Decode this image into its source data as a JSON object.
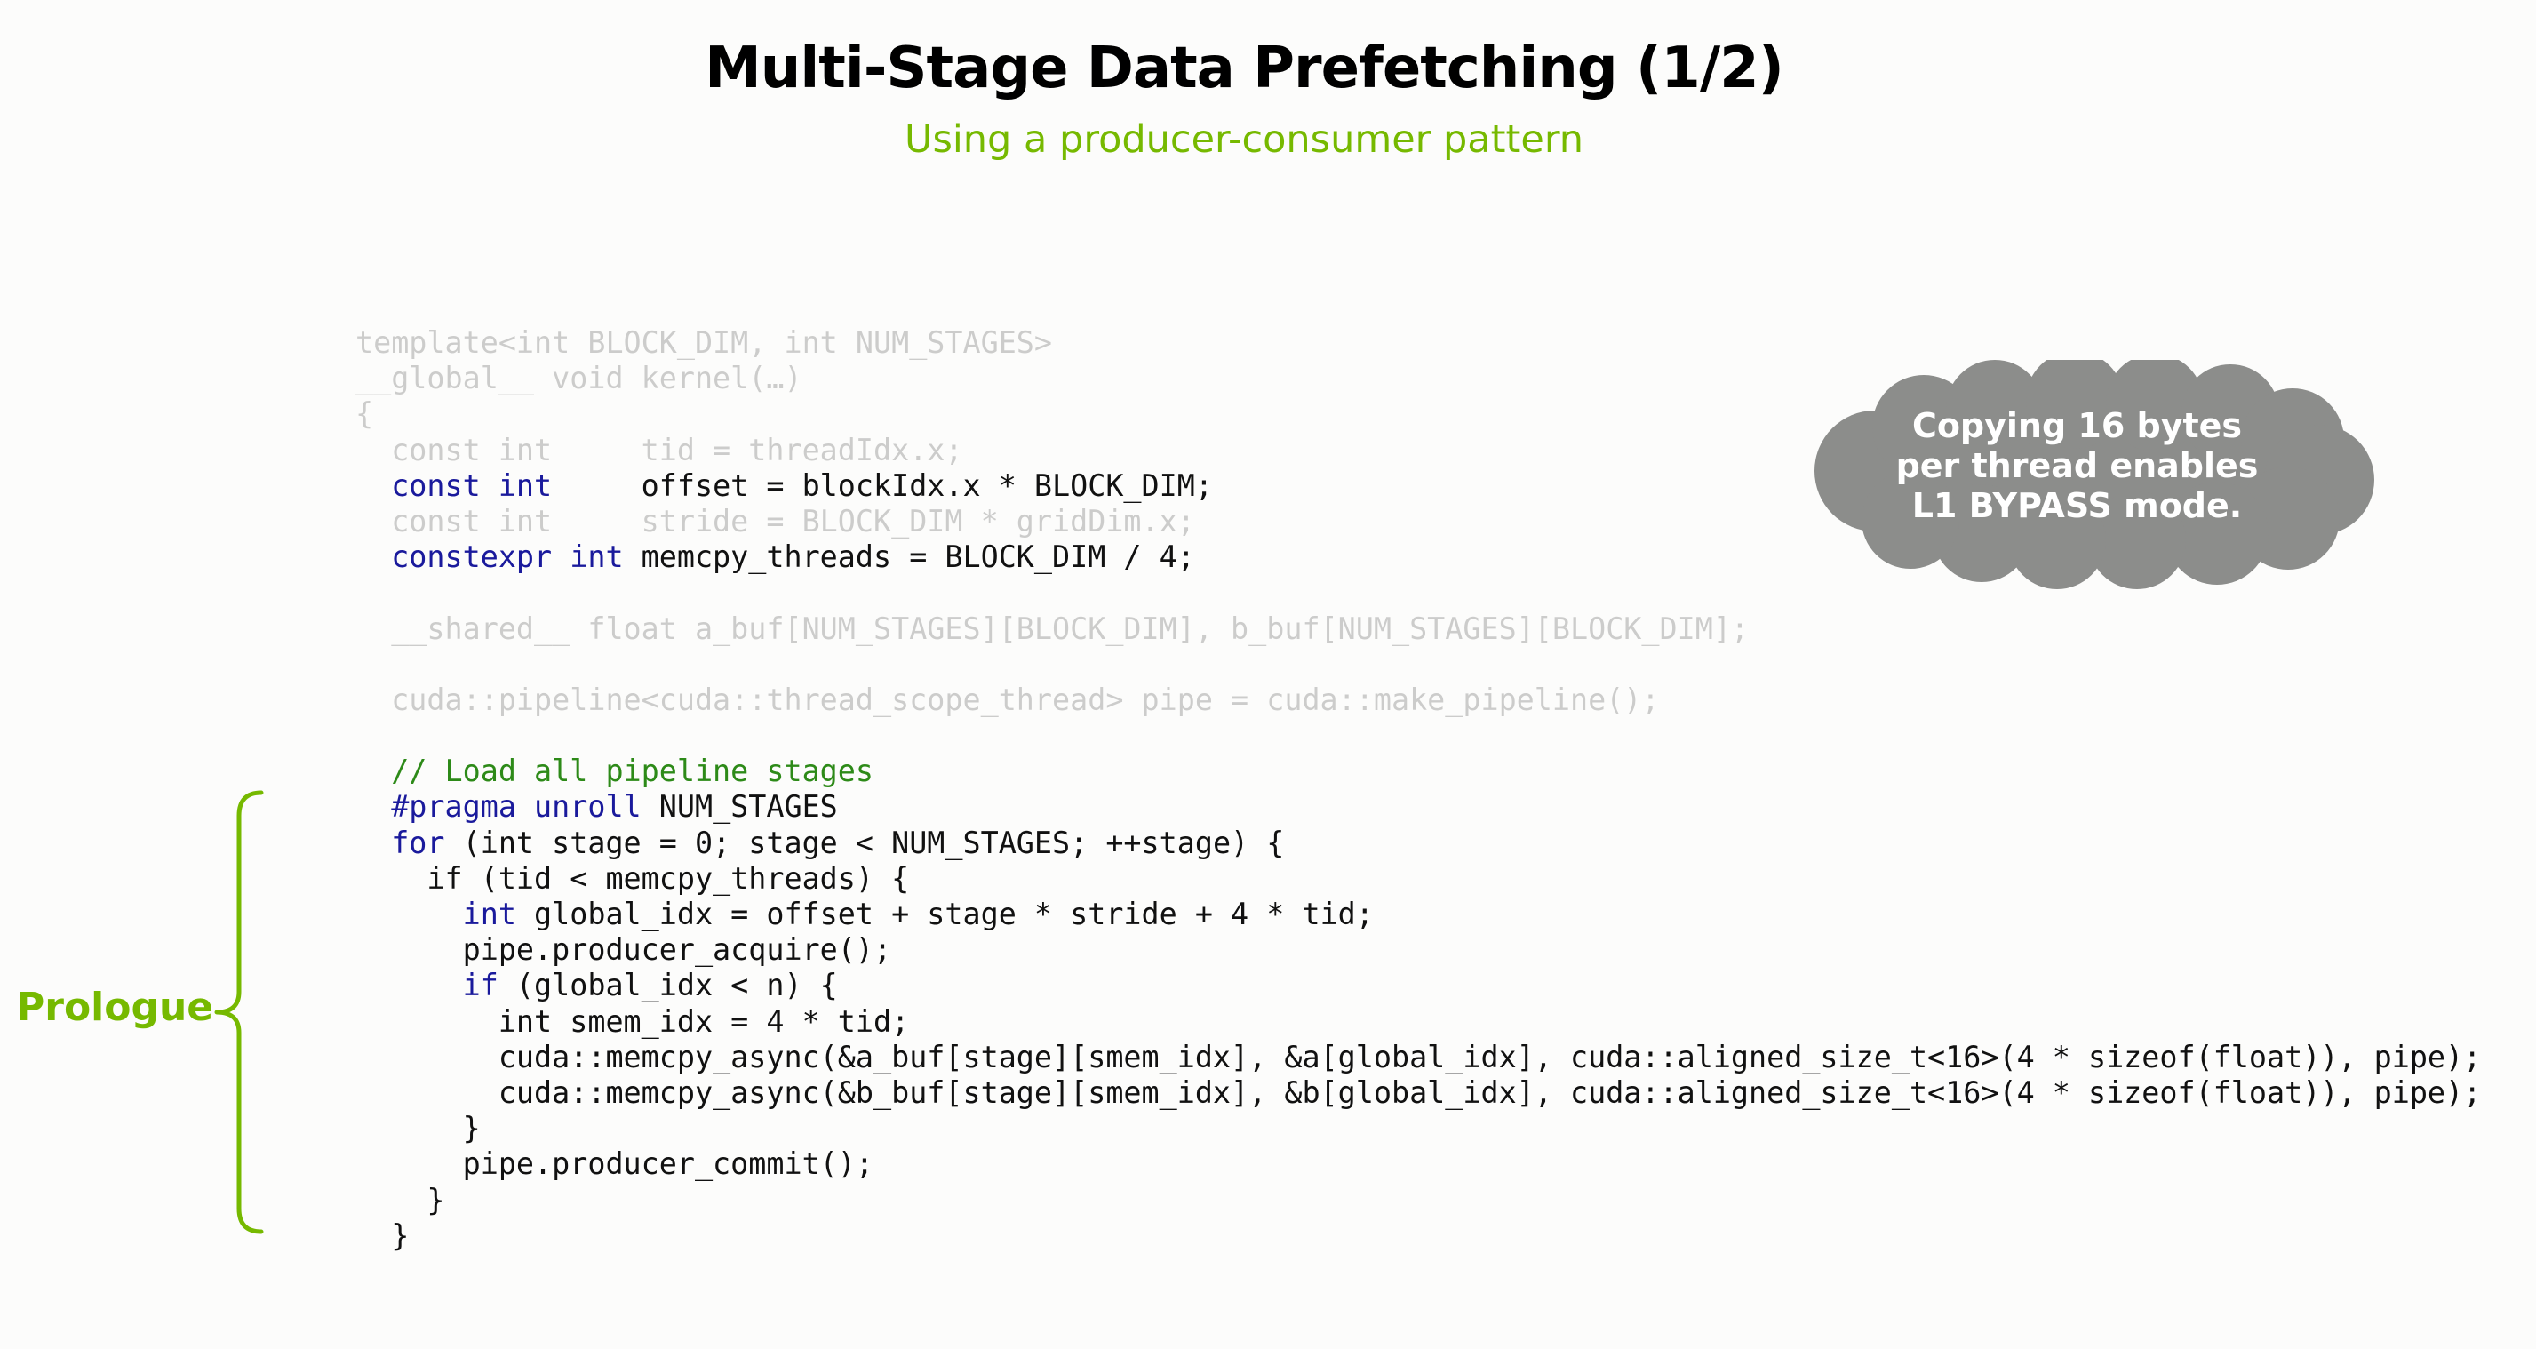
{
  "slide": {
    "title": "Multi-Stage Data Prefetching (1/2)",
    "subtitle": "Using a producer-consumer pattern"
  },
  "callout": {
    "line1": "Copying 16 bytes",
    "line2": "per thread enables",
    "line3": "L1 BYPASS mode."
  },
  "annotation": {
    "label": "Prologue"
  },
  "colors": {
    "accent_green": "#76b900",
    "keyword_blue": "#1a1a9c",
    "comment_green": "#2d8a18",
    "cloud_gray": "#8c8d8b"
  },
  "code": {
    "lines": [
      {
        "text": "template<int BLOCK_DIM, int NUM_STAGES>",
        "faded": true
      },
      {
        "text": "__global__ void kernel(…)",
        "faded": true
      },
      {
        "text": "{",
        "faded": true
      },
      {
        "text": "  const int     tid = threadIdx.x;",
        "faded": true
      },
      {
        "kw": "  const int",
        "text": "     offset = blockIdx.x * BLOCK_DIM;",
        "faded": false
      },
      {
        "text": "  const int     stride = BLOCK_DIM * gridDim.x;",
        "faded": true
      },
      {
        "kw": "  constexpr int",
        "text": " memcpy_threads = BLOCK_DIM / 4;",
        "faded": false
      },
      {
        "text": "",
        "faded": false
      },
      {
        "text": "  __shared__ float a_buf[NUM_STAGES][BLOCK_DIM], b_buf[NUM_STAGES][BLOCK_DIM];",
        "faded": true
      },
      {
        "text": "",
        "faded": false
      },
      {
        "text": "  cuda::pipeline<cuda::thread_scope_thread> pipe = cuda::make_pipeline();",
        "faded": true
      },
      {
        "text": "",
        "faded": false
      },
      {
        "cm": "  // Load all pipeline stages",
        "text": "",
        "faded": false
      },
      {
        "kw": "  #pragma unroll",
        "text": " NUM_STAGES",
        "faded": false
      },
      {
        "kw": "  for",
        "text": " (int stage = 0; stage < NUM_STAGES; ++stage) {",
        "faded": false
      },
      {
        "text": "    if (tid < memcpy_threads) {",
        "faded": false
      },
      {
        "kw": "      int",
        "text": " global_idx = offset + stage * stride + 4 * tid;",
        "faded": false
      },
      {
        "text": "      pipe.producer_acquire();",
        "faded": false
      },
      {
        "kw": "      if",
        "text": " (global_idx < n) {",
        "faded": false
      },
      {
        "text": "        int smem_idx = 4 * tid;",
        "faded": false
      },
      {
        "text": "        cuda::memcpy_async(&a_buf[stage][smem_idx], &a[global_idx], cuda::aligned_size_t<16>(4 * sizeof(float)), pipe);",
        "faded": false
      },
      {
        "text": "        cuda::memcpy_async(&b_buf[stage][smem_idx], &b[global_idx], cuda::aligned_size_t<16>(4 * sizeof(float)), pipe);",
        "faded": false
      },
      {
        "text": "      }",
        "faded": false
      },
      {
        "text": "      pipe.producer_commit();",
        "faded": false
      },
      {
        "text": "    }",
        "faded": false
      },
      {
        "text": "  }",
        "faded": false
      }
    ]
  }
}
